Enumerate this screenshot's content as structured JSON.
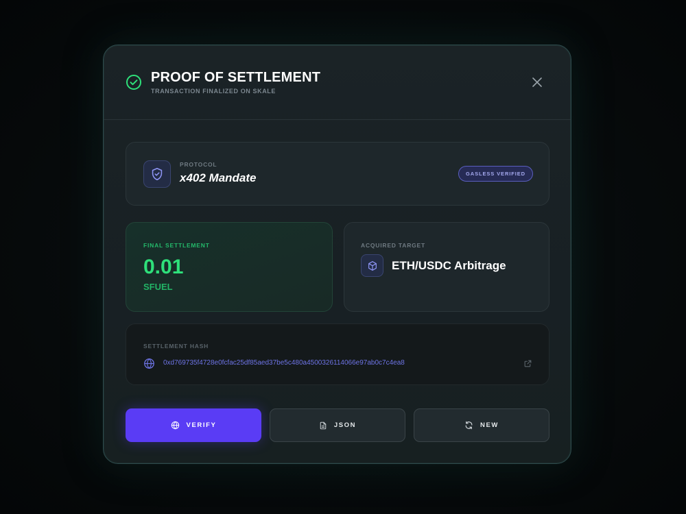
{
  "modal": {
    "title": "PROOF OF SETTLEMENT",
    "subtitle": "TRANSACTION FINALIZED ON SKALE"
  },
  "protocol": {
    "label": "PROTOCOL",
    "value": "x402 Mandate",
    "badge": "GASLESS VERIFIED"
  },
  "settlement": {
    "label": "FINAL SETTLEMENT",
    "amount": "0.01",
    "unit": "SFUEL"
  },
  "target": {
    "label": "ACQUIRED TARGET",
    "value": "ETH/USDC Arbitrage"
  },
  "hash": {
    "label": "SETTLEMENT HASH",
    "value": "0xd769735f4728e0fcfac25df85aed37be5c480a4500326114066e97ab0c7c4ea8"
  },
  "actions": {
    "verify": "VERIFY",
    "json": "JSON",
    "new": "NEW"
  },
  "icons": {
    "header": "check-circle-icon",
    "close": "close-icon",
    "protocol": "shield-check-icon",
    "target": "cube-icon",
    "hash": "globe-icon",
    "external": "external-link-icon",
    "verify": "globe-icon",
    "json": "file-icon",
    "new": "refresh-icon"
  },
  "colors": {
    "accent": "#5a3cf5",
    "success": "#2ee07a",
    "hash_text": "#6e74e6",
    "badge_text": "#a5a9ef"
  }
}
